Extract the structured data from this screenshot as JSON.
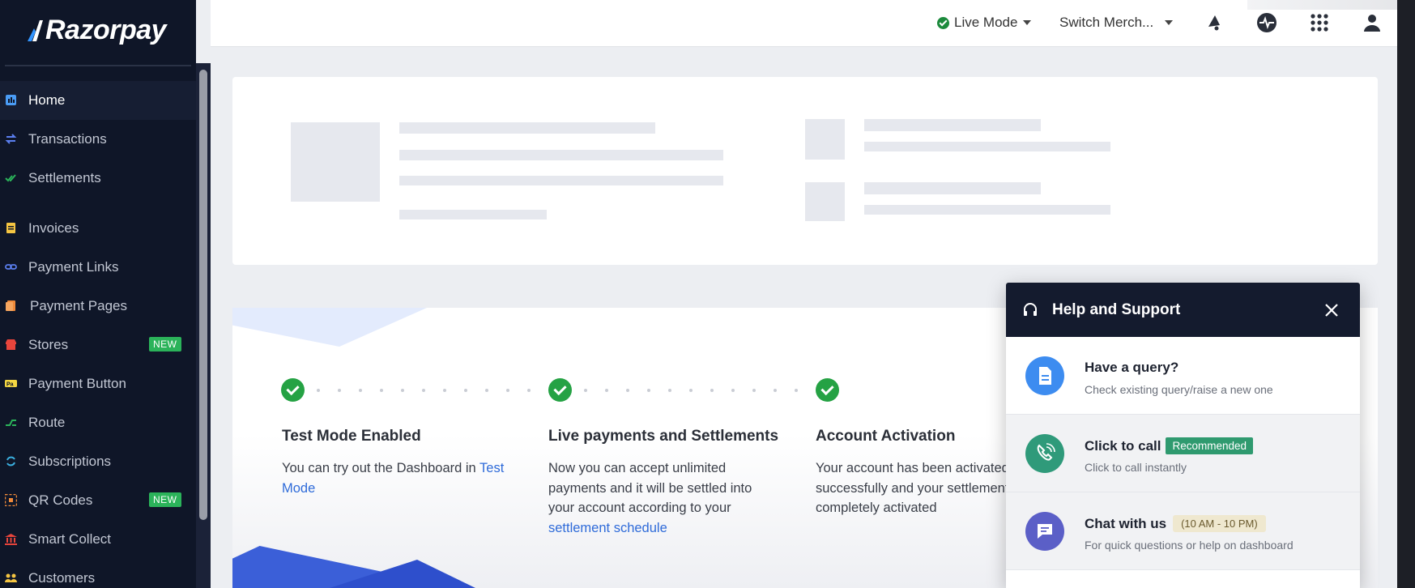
{
  "brand": {
    "name": "Razorpay"
  },
  "sidebar": {
    "items": [
      {
        "label": "Home",
        "icon": "dashboard-icon",
        "active": true
      },
      {
        "label": "Transactions",
        "icon": "transactions-icon"
      },
      {
        "label": "Settlements",
        "icon": "settlements-icon"
      },
      {
        "label": "Invoices",
        "icon": "invoices-icon"
      },
      {
        "label": "Payment Links",
        "icon": "link-icon"
      },
      {
        "label": "Payment Pages",
        "icon": "payment-pages-icon"
      },
      {
        "label": "Stores",
        "icon": "store-icon",
        "badge": "NEW"
      },
      {
        "label": "Payment Button",
        "icon": "payment-button-icon"
      },
      {
        "label": "Route",
        "icon": "route-icon"
      },
      {
        "label": "Subscriptions",
        "icon": "subscriptions-icon"
      },
      {
        "label": "QR Codes",
        "icon": "qr-code-icon",
        "badge": "NEW"
      },
      {
        "label": "Smart Collect",
        "icon": "bank-icon"
      },
      {
        "label": "Customers",
        "icon": "customers-icon"
      }
    ]
  },
  "topbar": {
    "mode_label": "Live Mode",
    "merchant_label": "Switch Merch...",
    "icons": [
      "announcement-icon",
      "activity-icon",
      "apps-grid-icon",
      "user-icon"
    ]
  },
  "onboarding": {
    "steps": [
      {
        "title": "Test Mode Enabled",
        "desc": "You can try out the Dashboard in ",
        "link": "Test Mode"
      },
      {
        "title": "Live payments and Settlements",
        "desc": "Now you can accept unlimited payments and it will be settled into your account according to your ",
        "link": "settlement schedule"
      },
      {
        "title": "Account Activation",
        "desc": "Your account has been activated successfully and your settlements completely activated"
      }
    ]
  },
  "help": {
    "title": "Help and Support",
    "rows": [
      {
        "title": "Have a query?",
        "subtitle": "Check existing query/raise a new one"
      },
      {
        "title": "Click to call",
        "tag": "Recommended",
        "subtitle": "Click to call instantly"
      },
      {
        "title": "Chat with us",
        "tag": "(10 AM - 10 PM)",
        "subtitle": "For quick questions or help on dashboard"
      }
    ]
  },
  "colors": {
    "sidebar_bg": "#0f1628",
    "accent_blue": "#2f6bd9",
    "success_green": "#25a244",
    "badge_green": "#2bb35a"
  }
}
